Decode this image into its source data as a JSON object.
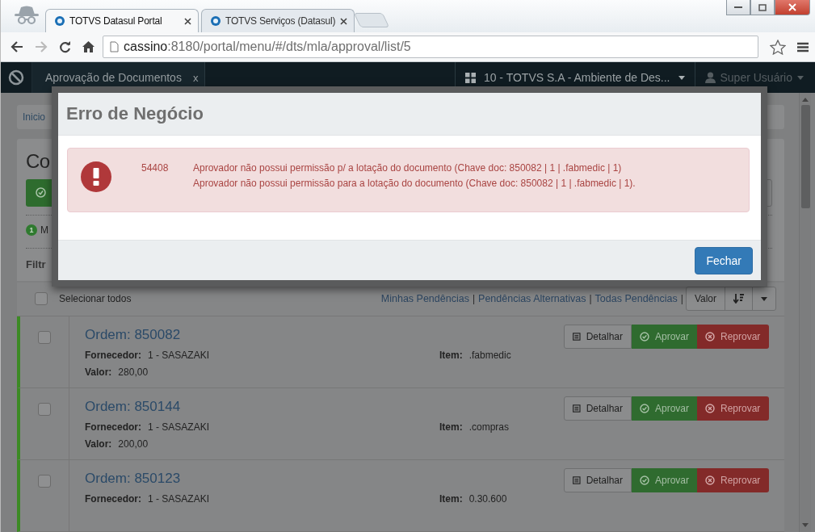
{
  "browser": {
    "tabs": [
      {
        "title": "TOTVS Datasul Portal",
        "selected": true
      },
      {
        "title": "TOTVS Serviços (Datasul)",
        "selected": false
      }
    ],
    "forward_disabled": true,
    "url": {
      "host": "cassino",
      "path": ":8180/portal/menu/#/dts/mla/approval/list/5"
    }
  },
  "app": {
    "nav_tab": {
      "label": "Aprovação de Documentos",
      "close": "x"
    },
    "company": "10 - TOTVS S.A - Ambiente de Des...",
    "user": "Super Usuário"
  },
  "page": {
    "breadcrumb": "Inicio",
    "heading": "Co",
    "counter": {
      "badge": "1",
      "label": "M"
    },
    "filter_label": "Filtr",
    "select_all": {
      "label": "Selecionar todos",
      "checked": false
    },
    "filters": [
      "Minhas Pendências",
      "Pendências Alternativas",
      "Todas Pendências"
    ],
    "filter_separator": "|",
    "sort": {
      "label": "Valor"
    },
    "orders": [
      {
        "title": "Ordem: 850082",
        "supplier_label": "Fornecedor:",
        "supplier": "1 - SASAZAKI",
        "item_label": "Item:",
        "item": ".fabmedic",
        "value_label": "Valor:",
        "value": "280,00",
        "checked": false,
        "actions": [
          "Detalhar",
          "Aprovar",
          "Reprovar"
        ]
      },
      {
        "title": "Ordem: 850144",
        "supplier_label": "Fornecedor:",
        "supplier": "1 - SASAZAKI",
        "item_label": "Item:",
        "item": ".compras",
        "value_label": "Valor:",
        "value": "200,00",
        "checked": false,
        "actions": [
          "Detalhar",
          "Aprovar",
          "Reprovar"
        ]
      },
      {
        "title": "Ordem: 850123",
        "supplier_label": "Fornecedor:",
        "supplier": "1 - SASAZAKI",
        "item_label": "Item:",
        "item": "0.30.600",
        "checked": false,
        "actions": [
          "Detalhar",
          "Aprovar",
          "Reprovar"
        ]
      }
    ]
  },
  "modal": {
    "title": "Erro de Negócio",
    "code": "54408",
    "messages": [
      "Aprovador não possui permissão p/ a lotação do documento (Chave doc: 850082 | 1 | .fabmedic | 1)",
      "Aprovador não possui permissão para a lotação do documento (Chave doc: 850082 | 1 | .fabmedic | 1)."
    ],
    "close_button": "Fechar"
  }
}
